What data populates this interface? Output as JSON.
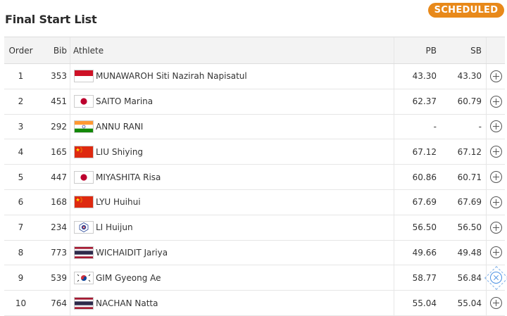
{
  "page": {
    "title": "Final Start List",
    "status": "SCHEDULED"
  },
  "colors": {
    "status_badge": "#e8891a",
    "header_bg": "#f3f3f3"
  },
  "table": {
    "headers": {
      "order": "Order",
      "bib": "Bib",
      "athlete": "Athlete",
      "pb": "PB",
      "sb": "SB"
    },
    "rows": [
      {
        "order": "1",
        "bib": "353",
        "flag": "indonesia-flag-icon",
        "athlete": "MUNAWAROH Siti Nazirah Napisatul",
        "pb": "43.30",
        "sb": "43.30"
      },
      {
        "order": "2",
        "bib": "451",
        "flag": "japan-flag-icon",
        "athlete": "SAITO Marina",
        "pb": "62.37",
        "sb": "60.79"
      },
      {
        "order": "3",
        "bib": "292",
        "flag": "india-flag-icon",
        "athlete": "ANNU RANI",
        "pb": "-",
        "sb": "-"
      },
      {
        "order": "4",
        "bib": "165",
        "flag": "china-flag-icon",
        "athlete": "LIU Shiying",
        "pb": "67.12",
        "sb": "67.12"
      },
      {
        "order": "5",
        "bib": "447",
        "flag": "japan-flag-icon",
        "athlete": "MIYASHITA Risa",
        "pb": "60.86",
        "sb": "60.71"
      },
      {
        "order": "6",
        "bib": "168",
        "flag": "china-flag-icon",
        "athlete": "LYU Huihui",
        "pb": "67.69",
        "sb": "67.69"
      },
      {
        "order": "7",
        "bib": "234",
        "flag": "chinese-taipei-flag-icon",
        "athlete": "LI Huijun",
        "pb": "56.50",
        "sb": "56.50"
      },
      {
        "order": "8",
        "bib": "773",
        "flag": "thailand-flag-icon",
        "athlete": "WICHAIDIT Jariya",
        "pb": "49.66",
        "sb": "49.48"
      },
      {
        "order": "9",
        "bib": "539",
        "flag": "korea-flag-icon",
        "athlete": "GIM Gyeong Ae",
        "pb": "58.77",
        "sb": "56.84"
      },
      {
        "order": "10",
        "bib": "764",
        "flag": "thailand-flag-icon",
        "athlete": "NACHAN Natta",
        "pb": "55.04",
        "sb": "55.04"
      }
    ]
  }
}
